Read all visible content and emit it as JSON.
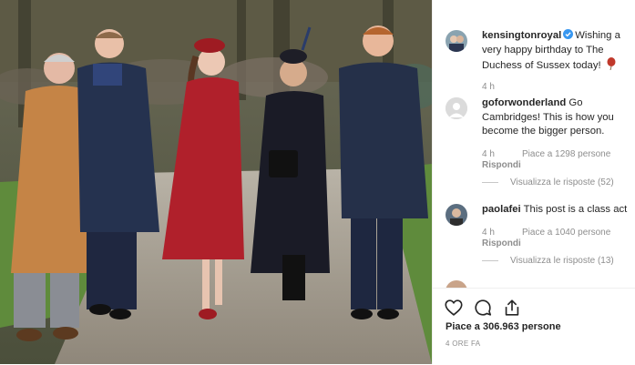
{
  "post": {
    "author": "kensingtonroyal",
    "caption_text": "Wishing a very happy birthday to The Duchess of Sussex today!",
    "time": "4 h"
  },
  "comments": [
    {
      "user": "goforwonderland",
      "text": "Go Cambridges! This is how you become the bigger person.",
      "time": "4 h",
      "likes": "Piace a 1298 persone",
      "reply": "Rispondi",
      "view_replies": "Visualizza le risposte (52)"
    },
    {
      "user": "paolafei",
      "text": "This post is a class act",
      "time": "4 h",
      "likes": "Piace a 1040 persone",
      "reply": "Rispondi",
      "view_replies": "Visualizza le risposte (13)"
    }
  ],
  "footer": {
    "likes_count": "Piace a 306.963 persone",
    "posted_ago": "4 ORE FA"
  },
  "icons": {
    "like": "heart-icon",
    "comment": "comment-icon",
    "share": "share-icon",
    "verified": "verified-badge-icon",
    "emoji": "balloon-emoji-icon"
  },
  "colors": {
    "verified": "#3897f0",
    "text": "#262626",
    "meta": "#8e8e8e",
    "balloon": "#c0392b"
  }
}
